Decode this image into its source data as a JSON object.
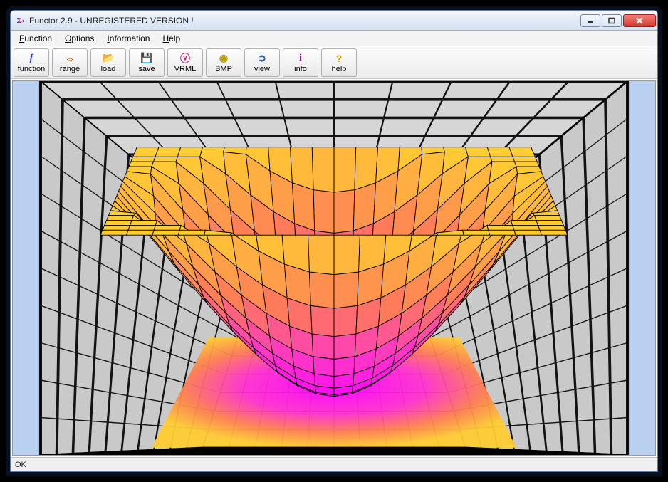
{
  "window": {
    "title": "Functor 2.9 - UNREGISTERED VERSION !",
    "icon_glyph": "Σ›"
  },
  "menu": {
    "function": "Function",
    "options": "Options",
    "information": "Information",
    "help": "Help"
  },
  "toolbar": {
    "function": {
      "label": "function",
      "glyph": "f",
      "color": "#2040d0"
    },
    "range": {
      "label": "range",
      "glyph": "⇔",
      "color": "#d04000"
    },
    "load": {
      "label": "load",
      "glyph": "📂",
      "color": "#c09000"
    },
    "save": {
      "label": "save",
      "glyph": "💾",
      "color": "#2040a0"
    },
    "vrml": {
      "label": "VRML",
      "glyph": "ⓥ",
      "color": "#c02080"
    },
    "bmp": {
      "label": "BMP",
      "glyph": "◉",
      "color": "#c0a000"
    },
    "view": {
      "label": "view",
      "glyph": "➲",
      "color": "#2060c0"
    },
    "info": {
      "label": "info",
      "glyph": "i",
      "color": "#c000a0"
    },
    "help": {
      "label": "help",
      "glyph": "?",
      "color": "#d0a000"
    }
  },
  "status": {
    "text": "OK"
  },
  "chart_data": {
    "type": "surface",
    "function_hint": "z = x^2 + y^2 (paraboloid)",
    "x_range": [
      -1,
      1
    ],
    "y_range": [
      -1,
      1
    ],
    "z_range_visible": [
      0,
      1
    ],
    "colormap": [
      "#ffcc33",
      "#ff8844",
      "#ff44aa",
      "#ff00ff"
    ],
    "grid_walls": true,
    "floor_heatmap": true,
    "title": "",
    "xlabel": "",
    "ylabel": "",
    "zlabel": ""
  }
}
